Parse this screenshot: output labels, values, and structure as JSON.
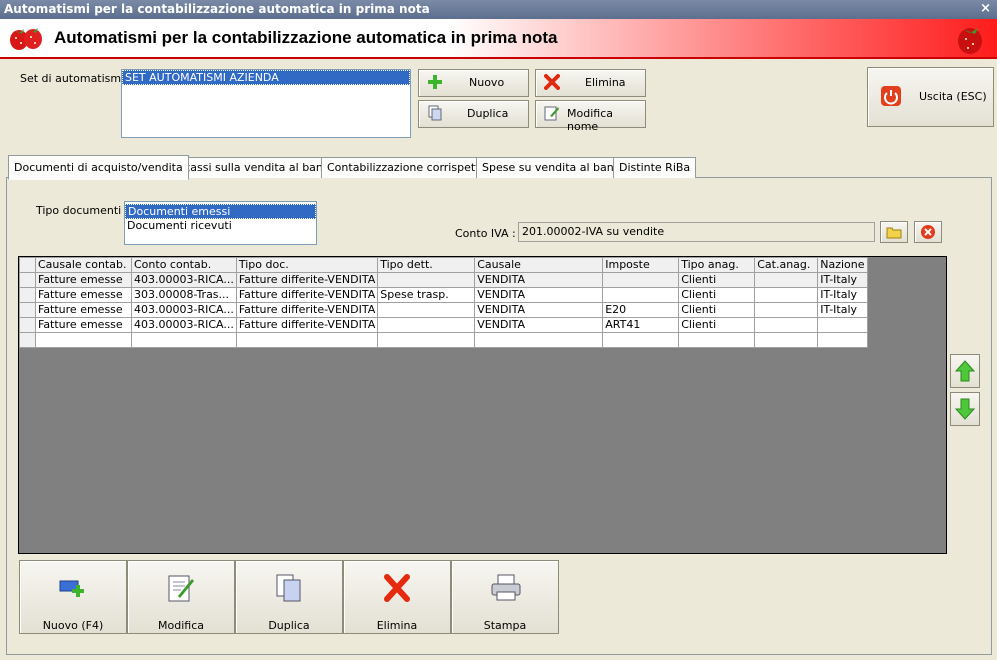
{
  "window": {
    "title": "Automatismi per la contabilizzazione automatica in prima nota",
    "close_glyph": "×"
  },
  "header": {
    "title": "Automatismi per la contabilizzazione automatica in prima nota"
  },
  "set": {
    "label": "Set di automatismi :",
    "items": [
      "SET AUTOMATISMI AZIENDA"
    ],
    "selected": 0
  },
  "buttons": {
    "nuovo": "Nuovo",
    "elimina": "Elimina",
    "duplica": "Duplica",
    "modifica_nome": "Modifica nome",
    "uscita": "Uscita (ESC)"
  },
  "tabs": [
    "Documenti di acquisto/vendita",
    "Incassi sulla vendita al banco",
    "Contabilizzazione corrispettivi",
    "Spese su vendita al banco",
    "Distinte RiBa"
  ],
  "active_tab": 0,
  "tipo_documenti": {
    "label": "Tipo documenti :",
    "items": [
      "Documenti emessi",
      "Documenti ricevuti"
    ],
    "selected": 0
  },
  "conto_iva": {
    "label": "Conto IVA :",
    "value": "201.00002-IVA su vendite"
  },
  "grid": {
    "columns": [
      "Causale contab.",
      "Conto contab.",
      "Tipo doc.",
      "Tipo dett.",
      "Causale",
      "Imposte",
      "Tipo anag.",
      "Cat.anag.",
      "Nazione"
    ],
    "rows": [
      [
        "Fatture emesse",
        "403.00003-RICA...",
        "Fatture differite-VENDITA",
        "",
        "VENDITA",
        "",
        "Clienti",
        "",
        "IT-Italy"
      ],
      [
        "Fatture emesse",
        "303.00008-Tras...",
        "Fatture differite-VENDITA",
        "Spese trasp.",
        "VENDITA",
        "",
        "Clienti",
        "",
        "IT-Italy"
      ],
      [
        "Fatture emesse",
        "403.00003-RICA...",
        "Fatture differite-VENDITA",
        "",
        "VENDITA",
        "E20",
        "Clienti",
        "",
        "IT-Italy"
      ],
      [
        "Fatture emesse",
        "403.00003-RICA...",
        "Fatture differite-VENDITA",
        "",
        "VENDITA",
        "ART41",
        "Clienti",
        "",
        ""
      ],
      [
        "",
        "",
        "",
        "",
        "",
        "",
        "",
        "",
        ""
      ]
    ]
  },
  "bottom_buttons": [
    "Nuovo (F4)",
    "Modifica",
    "Duplica",
    "Elimina",
    "Stampa"
  ],
  "colors": {
    "accent_red": "#ff1c1c",
    "selection": "#316ac5",
    "green_arrow": "#3cbf2f"
  }
}
